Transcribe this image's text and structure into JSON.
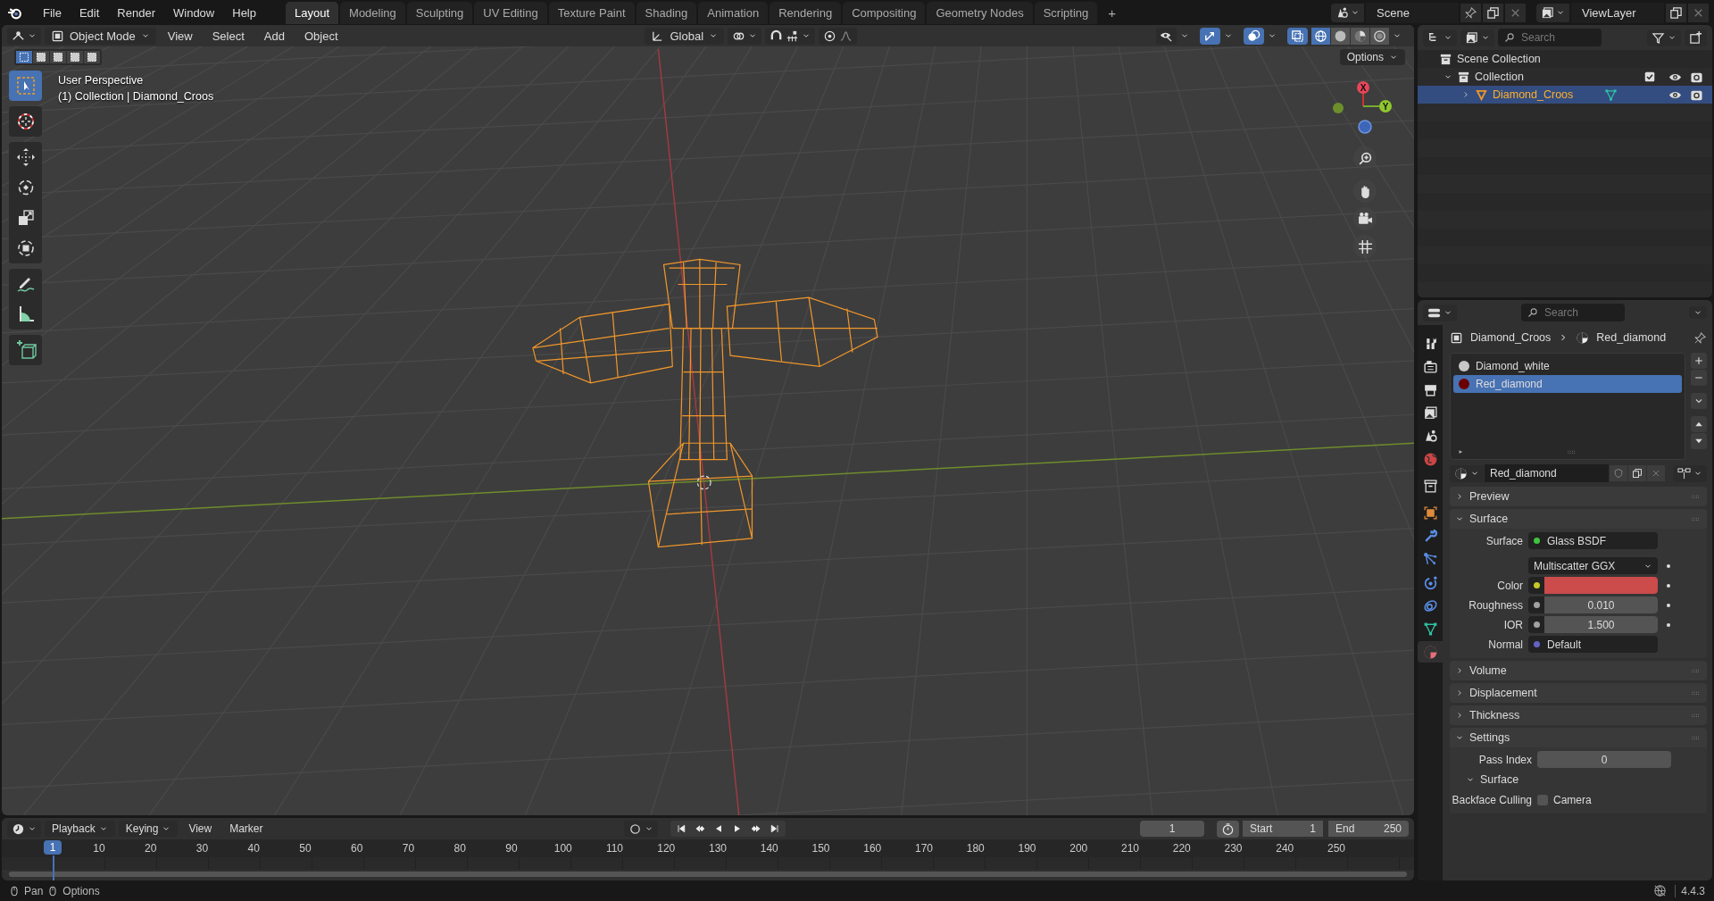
{
  "menu_bar": {
    "menus": [
      "File",
      "Edit",
      "Render",
      "Window",
      "Help"
    ],
    "workspace_tabs": [
      {
        "label": "Layout",
        "selected": true
      },
      {
        "label": "Modeling",
        "selected": false
      },
      {
        "label": "Sculpting",
        "selected": false
      },
      {
        "label": "UV Editing",
        "selected": false
      },
      {
        "label": "Texture Paint",
        "selected": false
      },
      {
        "label": "Shading",
        "selected": false
      },
      {
        "label": "Animation",
        "selected": false
      },
      {
        "label": "Rendering",
        "selected": false
      },
      {
        "label": "Compositing",
        "selected": false
      },
      {
        "label": "Geometry Nodes",
        "selected": false
      },
      {
        "label": "Scripting",
        "selected": false
      }
    ],
    "add_tab": "+",
    "scene": "Scene",
    "view_layer": "ViewLayer"
  },
  "viewport": {
    "mode": "Object Mode",
    "menus": [
      "View",
      "Select",
      "Add",
      "Object"
    ],
    "orientation": "Global",
    "options": "Options",
    "selection_modes": [
      {
        "selected": true
      },
      {
        "selected": false
      },
      {
        "selected": false
      },
      {
        "selected": false
      },
      {
        "selected": false
      }
    ],
    "header_toggles": [
      {
        "kind": "visibility",
        "selected": false
      },
      {
        "kind": "gizmo",
        "selected": true
      },
      {
        "kind": "overlay",
        "selected": true
      },
      {
        "kind": "xray",
        "selected": true
      }
    ],
    "shading": [
      {
        "kind": "wireframe",
        "selected": true
      },
      {
        "kind": "solid",
        "selected": false
      },
      {
        "kind": "material",
        "selected": false
      },
      {
        "kind": "rendered",
        "selected": false
      }
    ],
    "info": [
      "User Perspective",
      "(1) Collection | Diamond_Croos"
    ],
    "tool_groups": [
      [
        {
          "kind": "select",
          "selected": true
        }
      ],
      [
        {
          "kind": "cursor",
          "selected": false
        }
      ],
      [
        {
          "kind": "move",
          "selected": false
        },
        {
          "kind": "rotate",
          "selected": false
        },
        {
          "kind": "scale",
          "selected": false
        },
        {
          "kind": "transform",
          "selected": false
        }
      ],
      [
        {
          "kind": "annotate",
          "selected": false
        },
        {
          "kind": "measure",
          "selected": false
        }
      ],
      [
        {
          "kind": "add-cube",
          "selected": false
        }
      ]
    ],
    "gizmo_axes": [
      "X",
      "Y"
    ]
  },
  "outliner": {
    "search_placeholder": "Search",
    "tree": [
      {
        "label": "Scene Collection",
        "kind": "scene-collection",
        "selected": false,
        "children": [
          {
            "label": "Collection",
            "kind": "collection",
            "selected": false,
            "expanded": true,
            "checked": true,
            "children": [
              {
                "label": "Diamond_Croos",
                "kind": "object",
                "selected": true,
                "expanded": false
              }
            ]
          }
        ]
      }
    ]
  },
  "properties": {
    "search_placeholder": "Search",
    "tabs": [
      {
        "kind": "tool",
        "selected": false
      },
      {
        "kind": "render",
        "selected": false
      },
      {
        "kind": "output",
        "selected": false
      },
      {
        "kind": "view-layer",
        "selected": false
      },
      {
        "kind": "scene",
        "selected": false
      },
      {
        "kind": "world",
        "selected": false
      },
      {
        "kind": "collection",
        "selected": false
      },
      {
        "kind": "object",
        "selected": false
      },
      {
        "kind": "modifier",
        "selected": false
      },
      {
        "kind": "particles",
        "selected": false
      },
      {
        "kind": "physics",
        "selected": false
      },
      {
        "kind": "constraints",
        "selected": false
      },
      {
        "kind": "data",
        "selected": false
      },
      {
        "kind": "material",
        "selected": true
      }
    ],
    "breadcrumb": [
      "Diamond_Croos",
      "Red_diamond"
    ],
    "material_slots": [
      {
        "name": "Diamond_white",
        "color": "#c8c8c8",
        "selected": false
      },
      {
        "name": "Red_diamond",
        "color": "#6a0000",
        "selected": true
      }
    ],
    "material_name": "Red_diamond",
    "panels": [
      {
        "title": "Preview",
        "expanded": false
      },
      {
        "title": "Surface",
        "expanded": true,
        "rows": [
          {
            "kind": "link",
            "label": "Surface",
            "value": "Glass BSDF",
            "color": "#3ec43e"
          },
          {
            "kind": "dropdown",
            "value": "Multiscatter GGX",
            "animatable": true
          },
          {
            "kind": "color",
            "label": "Color",
            "color": "#c7c729",
            "swatch": {
              "color": "#cc4b4b"
            },
            "animatable": true
          },
          {
            "kind": "number",
            "label": "Roughness",
            "value": "0.010",
            "color": "#a1a1a1",
            "animatable": true
          },
          {
            "kind": "number",
            "label": "IOR",
            "value": "1.500",
            "color": "#a1a1a1",
            "animatable": true
          },
          {
            "kind": "link",
            "label": "Normal",
            "value": "Default",
            "color": "#6363c7"
          }
        ]
      },
      {
        "title": "Volume",
        "expanded": false
      },
      {
        "title": "Displacement",
        "expanded": false
      },
      {
        "title": "Thickness",
        "expanded": false
      },
      {
        "title": "Settings",
        "expanded": true,
        "rows": [
          {
            "kind": "plain-number",
            "label": "Pass Index",
            "value": "0"
          },
          {
            "kind": "subpanel",
            "label": "Surface",
            "expanded": true
          },
          {
            "kind": "checkbox",
            "label": "Backface Culling",
            "value": "Camera",
            "checked": false
          }
        ]
      }
    ]
  },
  "timeline": {
    "menus": [
      {
        "label": "Playback",
        "dropdown": true
      },
      {
        "label": "Keying",
        "dropdown": true
      },
      {
        "label": "View",
        "dropdown": false
      },
      {
        "label": "Marker",
        "dropdown": false
      }
    ],
    "current_frame": "1",
    "start_label": "Start",
    "start": "1",
    "end_label": "End",
    "end": "250",
    "marker": "1",
    "ticks": [
      "10",
      "20",
      "30",
      "40",
      "50",
      "60",
      "70",
      "80",
      "90",
      "100",
      "110",
      "120",
      "130",
      "140",
      "150",
      "160",
      "170",
      "180",
      "190",
      "200",
      "210",
      "220",
      "230",
      "240",
      "250"
    ]
  },
  "status_bar": {
    "hints": [
      "Pan",
      "Options"
    ],
    "version": "4.4.3"
  }
}
